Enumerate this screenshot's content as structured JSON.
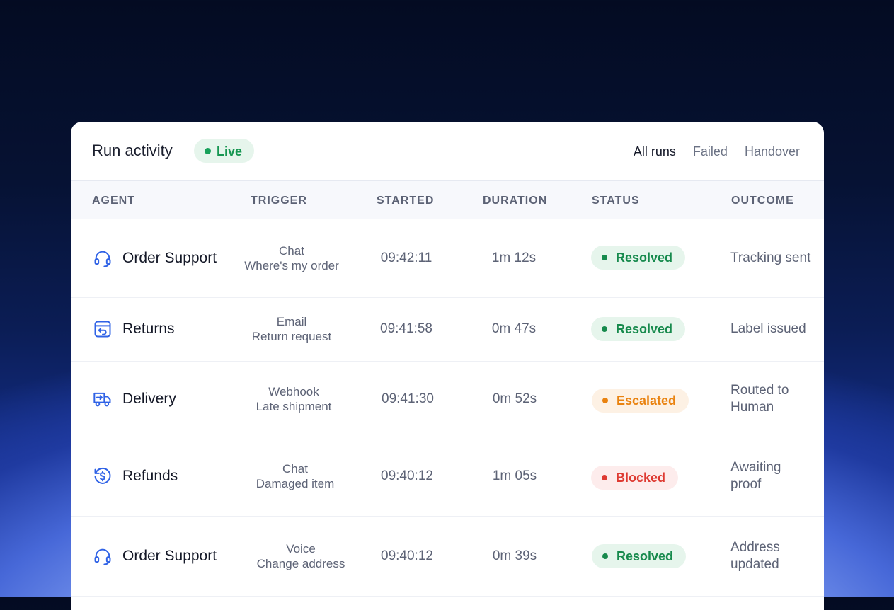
{
  "header": {
    "title": "Run activity",
    "live_label": "Live",
    "filters": [
      "All runs",
      "Failed",
      "Handover"
    ]
  },
  "columns": [
    "AGENT",
    "TRIGGER",
    "STARTED",
    "DURATION",
    "STATUS",
    "OUTCOME"
  ],
  "rows": [
    {
      "agent": "Order Support",
      "icon": "headset-icon",
      "trigger_type": "Chat",
      "trigger_detail": "Where's my order",
      "started": "09:42:11",
      "duration": "1m 12s",
      "status": "Resolved",
      "outcome": "Tracking sent"
    },
    {
      "agent": "Returns",
      "icon": "return-box-icon",
      "trigger_type": "Email",
      "trigger_detail": "Return request",
      "started": "09:41:58",
      "duration": "0m 47s",
      "status": "Resolved",
      "outcome": "Label issued"
    },
    {
      "agent": "Delivery",
      "icon": "delivery-truck-icon",
      "trigger_type": "Webhook",
      "trigger_detail": "Late shipment",
      "started": "09:41:30",
      "duration": "0m 52s",
      "status": "Escalated",
      "outcome": "Routed to Human"
    },
    {
      "agent": "Refunds",
      "icon": "refund-dollar-icon",
      "trigger_type": "Chat",
      "trigger_detail": "Damaged item",
      "started": "09:40:12",
      "duration": "1m 05s",
      "status": "Blocked",
      "outcome": "Awaiting proof"
    },
    {
      "agent": "Order Support",
      "icon": "headset-icon",
      "trigger_type": "Voice",
      "trigger_detail": "Change address",
      "started": "09:40:12",
      "duration": "0m 39s",
      "status": "Resolved",
      "outcome": "Address updated"
    }
  ],
  "colors": {
    "accent_icon": "#2f62e6",
    "resolved": "#178a4d",
    "escalated": "#e9820f",
    "blocked": "#de3a32"
  }
}
